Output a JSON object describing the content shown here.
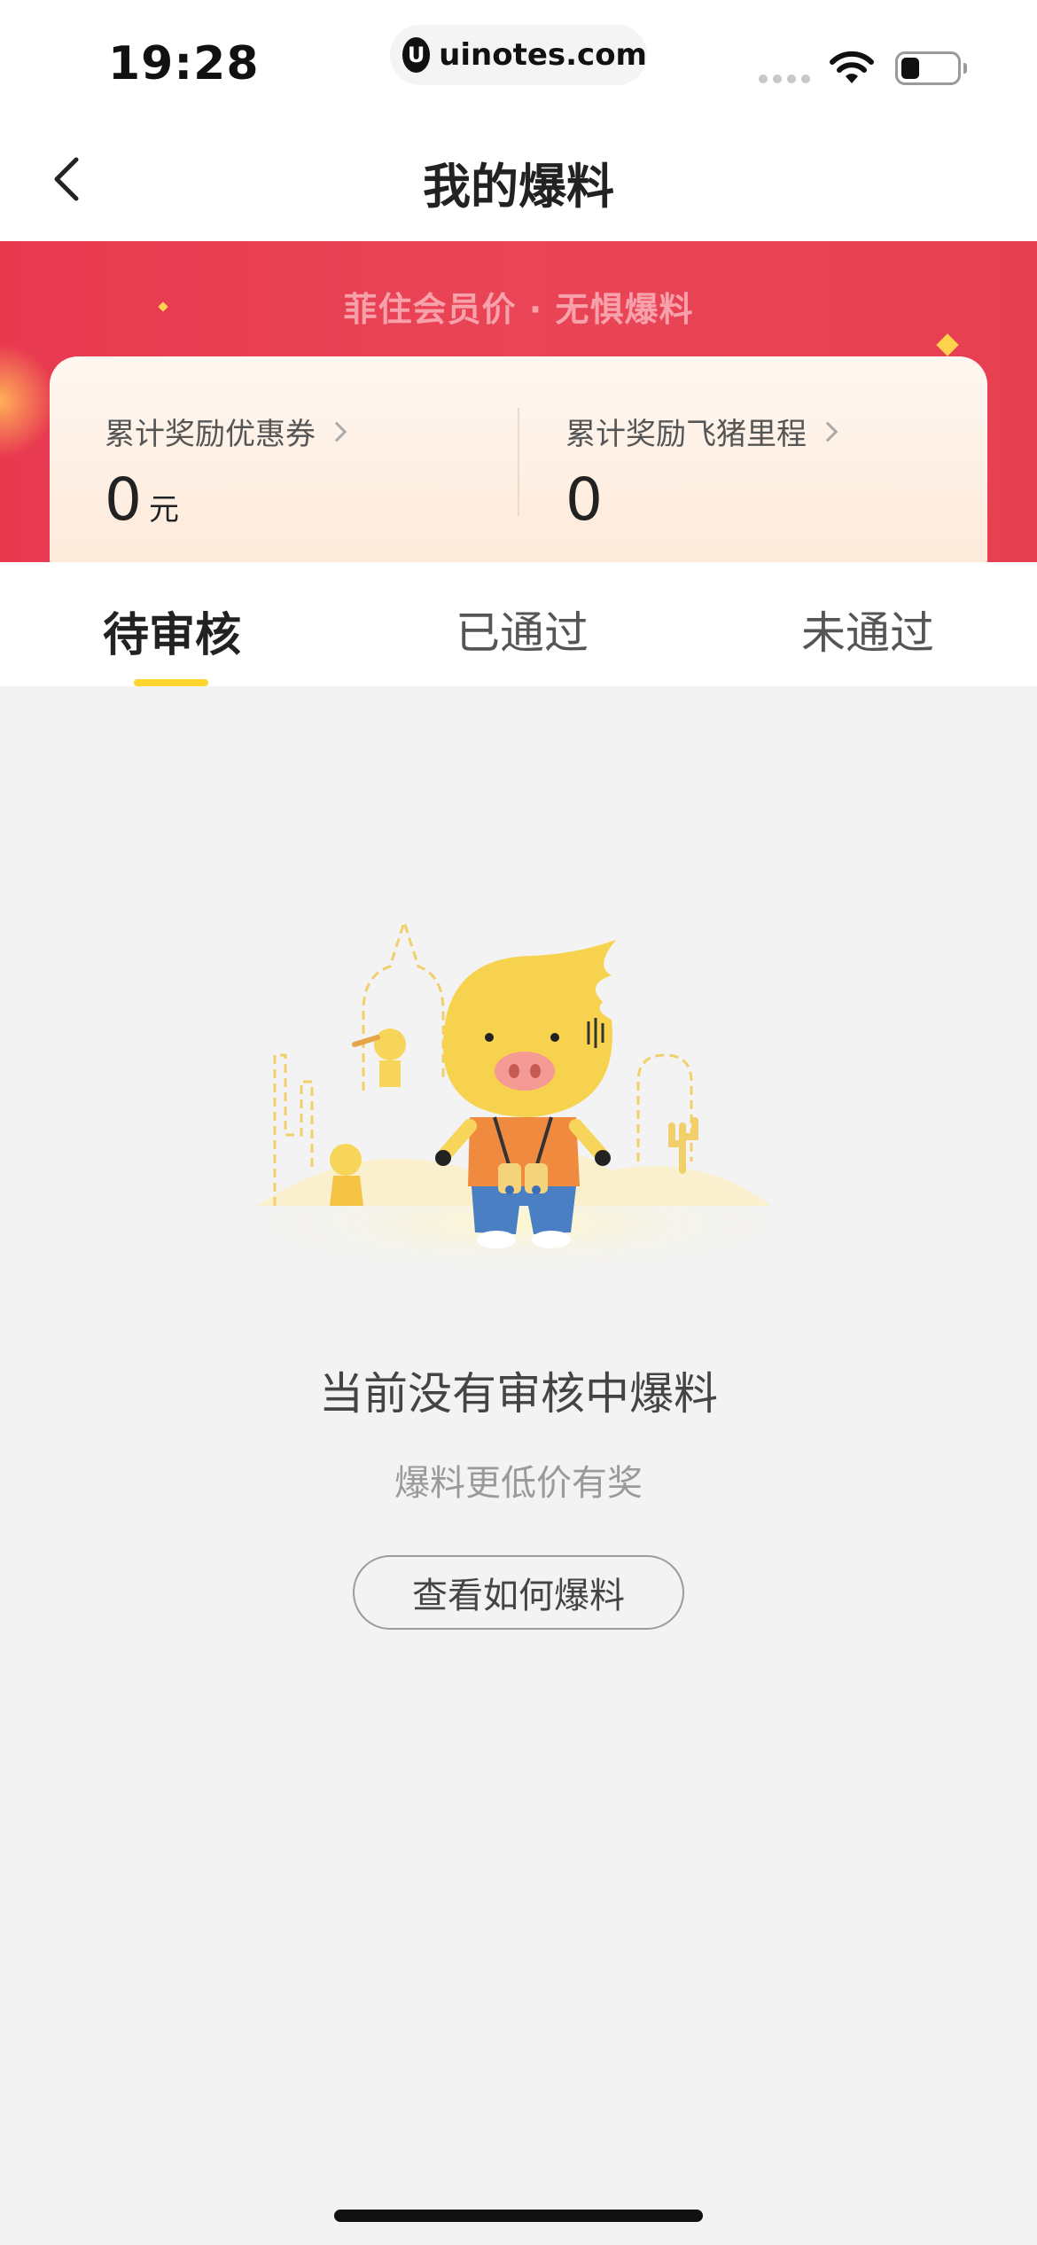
{
  "status_bar": {
    "time": "19:28",
    "url": "uinotes.com",
    "url_logo_letter": "U"
  },
  "nav": {
    "title": "我的爆料",
    "back_icon": "chevron-left-icon"
  },
  "banner": {
    "slogan": "菲住会员价 · 无惧爆料",
    "coupon_label": "累计奖励优惠券",
    "coupon_value": "0",
    "coupon_unit": "元",
    "miles_label": "累计奖励飞猪里程",
    "miles_value": "0",
    "accent_color": "#e8394f"
  },
  "tabs": [
    {
      "label": "待审核",
      "active": true
    },
    {
      "label": "已通过",
      "active": false
    },
    {
      "label": "未通过",
      "active": false
    }
  ],
  "empty_state": {
    "title": "当前没有审核中爆料",
    "subtitle": "爆料更低价有奖",
    "button_label": "查看如何爆料",
    "illustration": "fliggy-pig-mascot-with-binoculars"
  },
  "colors": {
    "tab_indicator": "#ffd530",
    "page_background": "#f3f3f3"
  }
}
